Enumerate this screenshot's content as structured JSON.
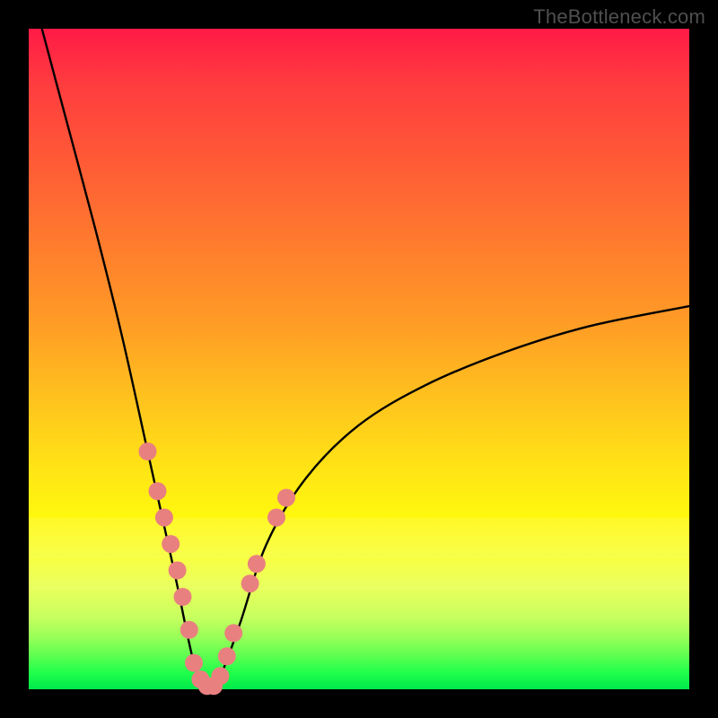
{
  "watermark": "TheBottleneck.com",
  "colors": {
    "dot": "#e98080",
    "curve": "#000000",
    "frame": "#000000"
  },
  "chart_data": {
    "type": "line",
    "title": "",
    "xlabel": "",
    "ylabel": "",
    "xlim": [
      0,
      100
    ],
    "ylim": [
      0,
      100
    ],
    "grid": false,
    "legend": false,
    "curve": {
      "description": "V-shaped bottleneck curve; y roughly 0 near x≈27, rising steeply to ~100 at x≈2 (left) and asymptotically toward ~55–60 at x=100 (right).",
      "min_x": 27
    },
    "series": [
      {
        "name": "bottleneck-curve",
        "points": [
          {
            "x": 2,
            "y": 100
          },
          {
            "x": 6,
            "y": 85
          },
          {
            "x": 10,
            "y": 70
          },
          {
            "x": 14,
            "y": 54
          },
          {
            "x": 18,
            "y": 36
          },
          {
            "x": 22,
            "y": 18
          },
          {
            "x": 25,
            "y": 4
          },
          {
            "x": 27,
            "y": 0
          },
          {
            "x": 29,
            "y": 2
          },
          {
            "x": 32,
            "y": 10
          },
          {
            "x": 36,
            "y": 22
          },
          {
            "x": 42,
            "y": 32
          },
          {
            "x": 50,
            "y": 40
          },
          {
            "x": 60,
            "y": 46
          },
          {
            "x": 72,
            "y": 51
          },
          {
            "x": 85,
            "y": 55
          },
          {
            "x": 100,
            "y": 58
          }
        ]
      },
      {
        "name": "highlight-dots",
        "points": [
          {
            "x": 18.0,
            "y": 36.0
          },
          {
            "x": 19.5,
            "y": 30.0
          },
          {
            "x": 20.5,
            "y": 26.0
          },
          {
            "x": 21.5,
            "y": 22.0
          },
          {
            "x": 22.5,
            "y": 18.0
          },
          {
            "x": 23.3,
            "y": 14.0
          },
          {
            "x": 24.3,
            "y": 9.0
          },
          {
            "x": 25.0,
            "y": 4.0
          },
          {
            "x": 26.0,
            "y": 1.5
          },
          {
            "x": 27.0,
            "y": 0.5
          },
          {
            "x": 28.0,
            "y": 0.5
          },
          {
            "x": 29.0,
            "y": 2.0
          },
          {
            "x": 30.0,
            "y": 5.0
          },
          {
            "x": 31.0,
            "y": 8.5
          },
          {
            "x": 33.5,
            "y": 16.0
          },
          {
            "x": 34.5,
            "y": 19.0
          },
          {
            "x": 37.5,
            "y": 26.0
          },
          {
            "x": 39.0,
            "y": 29.0
          }
        ]
      }
    ]
  }
}
